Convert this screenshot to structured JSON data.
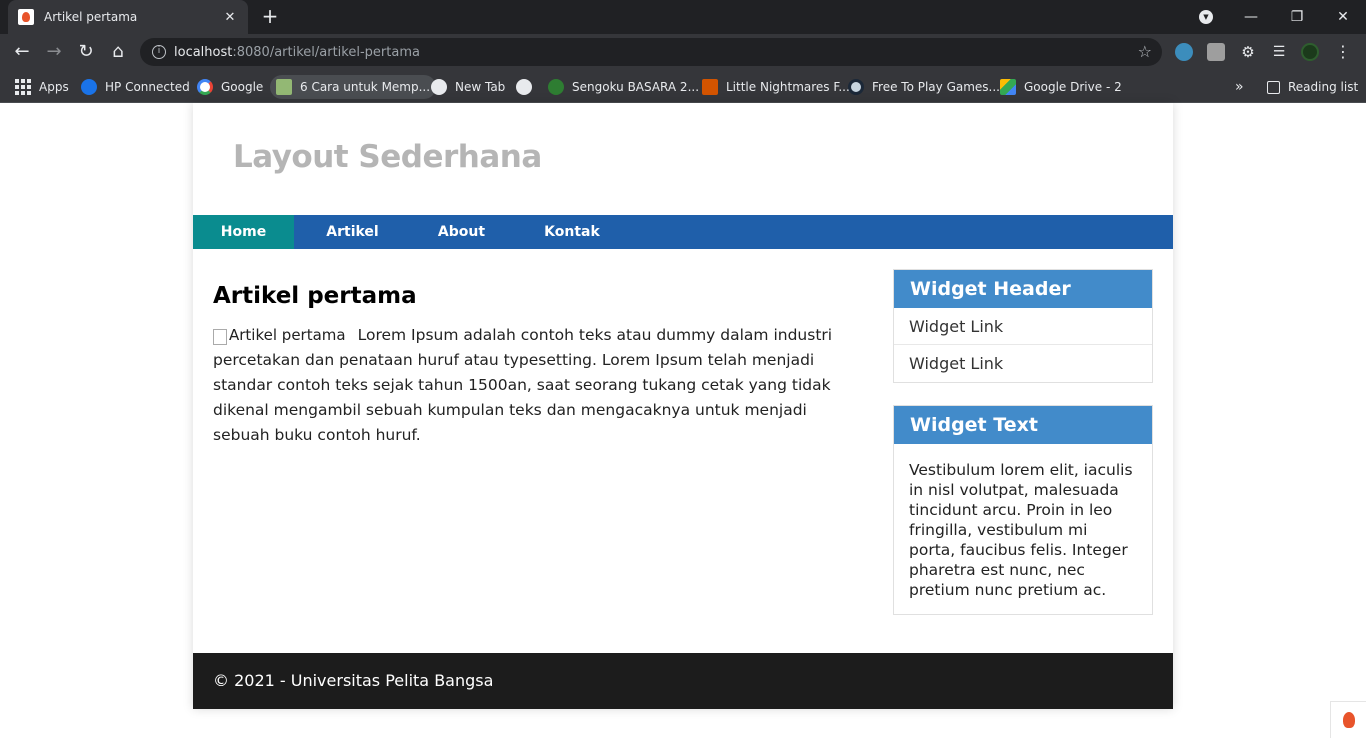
{
  "browser": {
    "tab_title": "Artikel pertama",
    "tab_close": "✕",
    "new_tab": "+",
    "url_host": "localhost",
    "url_path": ":8080/artikel/artikel-pertama",
    "reading_list": "Reading list",
    "bookmarks_overflow": "»",
    "bookmarks": [
      {
        "label": "Apps",
        "icon": "apps-grid-icon",
        "color": "#e8eaed"
      },
      {
        "label": "HP Connected",
        "icon": "hp-icon",
        "color": "#1a73e8"
      },
      {
        "label": "Google",
        "icon": "google-icon",
        "color": "#ffffff"
      },
      {
        "label": "6 Cara untuk Memp...",
        "icon": "wikihow-icon",
        "color": "#93b874"
      },
      {
        "label": "New Tab",
        "icon": "globe-icon",
        "color": "#e8eaed"
      },
      {
        "label": "",
        "icon": "globe-icon",
        "color": "#e8eaed"
      },
      {
        "label": "Sengoku BASARA 2...",
        "icon": "sengoku-icon",
        "color": "#2e7d32"
      },
      {
        "label": "Little Nightmares F...",
        "icon": "windows-icon",
        "color": "#d35400"
      },
      {
        "label": "Free To Play Games...",
        "icon": "steam-icon",
        "color": "#1b2838"
      },
      {
        "label": "Google Drive - 2",
        "icon": "google-drive-icon",
        "color": "#fbbc04"
      }
    ]
  },
  "site": {
    "title": "Layout Sederhana",
    "nav": [
      {
        "label": "Home",
        "active": true
      },
      {
        "label": "Artikel",
        "active": false
      },
      {
        "label": "About",
        "active": false
      },
      {
        "label": "Kontak",
        "active": false
      }
    ]
  },
  "article": {
    "title": "Artikel pertama",
    "image_alt": "Artikel pertama",
    "body": "Lorem Ipsum adalah contoh teks atau dummy dalam industri percetakan dan penataan huruf atau typesetting. Lorem Ipsum telah menjadi standar contoh teks sejak tahun 1500an, saat seorang tukang cetak yang tidak dikenal mengambil sebuah kumpulan teks dan mengacaknya untuk menjadi sebuah buku contoh huruf."
  },
  "sidebar": {
    "widget1": {
      "header": "Widget Header",
      "links": [
        "Widget Link",
        "Widget Link"
      ]
    },
    "widget2": {
      "header": "Widget Text",
      "text": "Vestibulum lorem elit, iaculis in nisl volutpat, malesuada tincidunt arcu. Proin in leo fringilla, vestibulum mi porta, faucibus felis. Integer pharetra est nunc, nec pretium nunc pretium ac."
    }
  },
  "footer": {
    "text": "© 2021 - Universitas Pelita Bangsa"
  },
  "colors": {
    "nav_bg": "#1f5faa",
    "nav_active": "#0a8c8f",
    "widget_header": "#428bca",
    "footer_bg": "#1c1c1c",
    "site_title": "#b5b5b5"
  }
}
